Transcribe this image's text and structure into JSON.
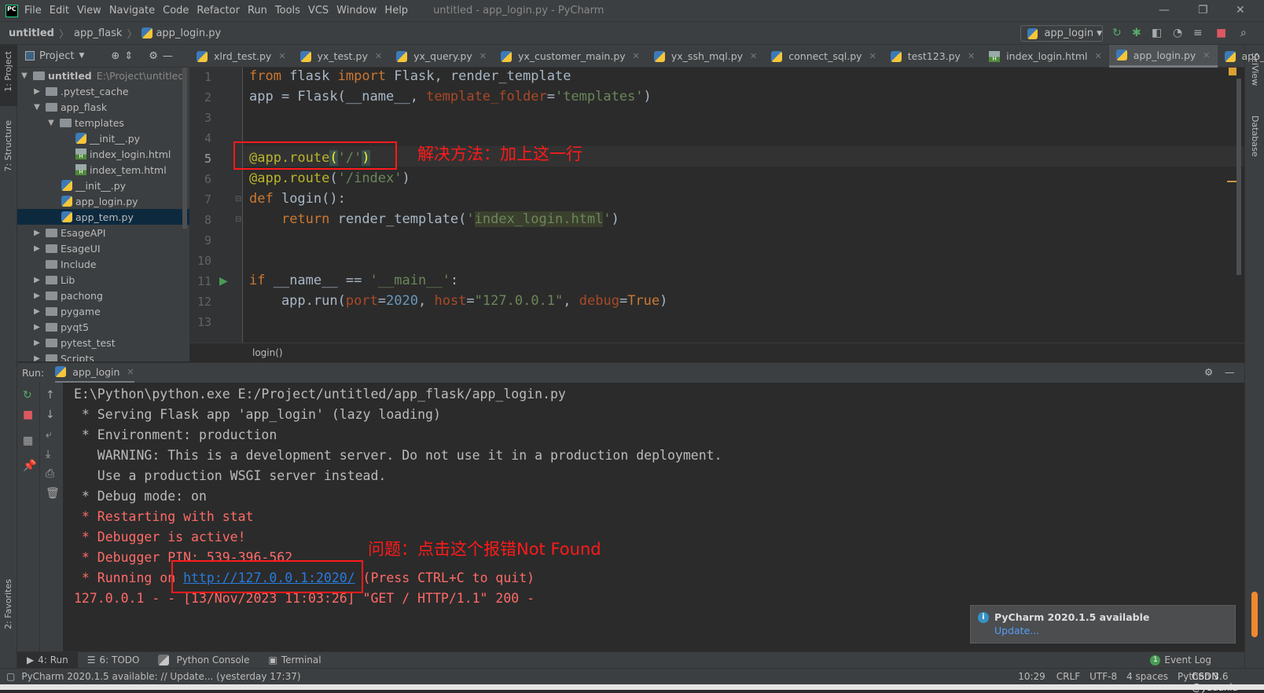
{
  "titlebar": {
    "menu": [
      "File",
      "Edit",
      "View",
      "Navigate",
      "Code",
      "Refactor",
      "Run",
      "Tools",
      "VCS",
      "Window",
      "Help"
    ],
    "title": "untitled - app_login.py - PyCharm"
  },
  "navbar": {
    "crumbs": [
      "untitled",
      "app_flask",
      "app_login.py"
    ],
    "run_config": "app_login"
  },
  "left_stripe": {
    "project": "1: Project",
    "structure": "7: Structure",
    "favorites": "2: Favorites"
  },
  "right_stripe": {
    "sciview": "SciView",
    "database": "Database"
  },
  "project": {
    "header": "Project",
    "root": "untitled",
    "root_path": "E:\\Project\\untitled",
    "items": [
      ".pytest_cache",
      "app_flask",
      "templates",
      "__init__.py",
      "index_login.html",
      "index_tem.html",
      "__init__.py",
      "app_login.py",
      "app_tem.py",
      "EsageAPI",
      "EsageUI",
      "Include",
      "Lib",
      "pachong",
      "pygame",
      "pyqt5",
      "pytest_test",
      "Scripts"
    ]
  },
  "tabs": [
    "xlrd_test.py",
    "yx_test.py",
    "yx_query.py",
    "yx_customer_main.py",
    "yx_ssh_mql.py",
    "connect_sql.py",
    "test123.py",
    "index_login.html",
    "app_login.py",
    "app_tem.py"
  ],
  "active_tab": "app_login.py",
  "editor": {
    "line_numbers": [
      "1",
      "2",
      "3",
      "4",
      "5",
      "6",
      "7",
      "8",
      "9",
      "10",
      "11",
      "12",
      "13"
    ],
    "breadcrumb": "login()",
    "annotation_fix": "解决方法：加上这一行",
    "current_line": 5
  },
  "run": {
    "label": "Run:",
    "tab": "app_login",
    "lines": [
      "E:\\Python\\python.exe E:/Project/untitled/app_flask/app_login.py",
      " * Serving Flask app 'app_login' (lazy loading)",
      " * Environment: production",
      "   WARNING: This is a development server. Do not use it in a production deployment.",
      "   Use a production WSGI server instead.",
      " * Debug mode: on",
      " * Restarting with stat",
      " * Debugger is active!",
      " * Debugger PIN: 539-396-562",
      " * Running on ",
      "http://127.0.0.1:2020/",
      " (Press CTRL+C to quit)",
      "127.0.0.1 - - [13/Nov/2023 11:03:26] \"GET / HTTP/1.1\" 200 -"
    ],
    "annotation_problem": "问题：点击这个报错Not Found"
  },
  "notification": {
    "title": "PyCharm 2020.1.5 available",
    "link": "Update..."
  },
  "bottom_tabs": [
    "4: Run",
    "6: TODO",
    "Python Console",
    "Terminal"
  ],
  "event_log": {
    "count": "1",
    "label": "Event Log"
  },
  "status": {
    "message": "PyCharm 2020.1.5 available: // Update... (yesterday 17:37)",
    "position": "10:29",
    "line_sep": "CRLF",
    "encoding": "UTF-8",
    "indent": "4 spaces",
    "interpreter": "Python 3.6",
    "watermark": "CSDN @yaaaxia"
  },
  "colors": {
    "accent_red": "#ff1a1a",
    "link": "#287bde",
    "keyword": "#cc7832",
    "string": "#6a8759"
  }
}
